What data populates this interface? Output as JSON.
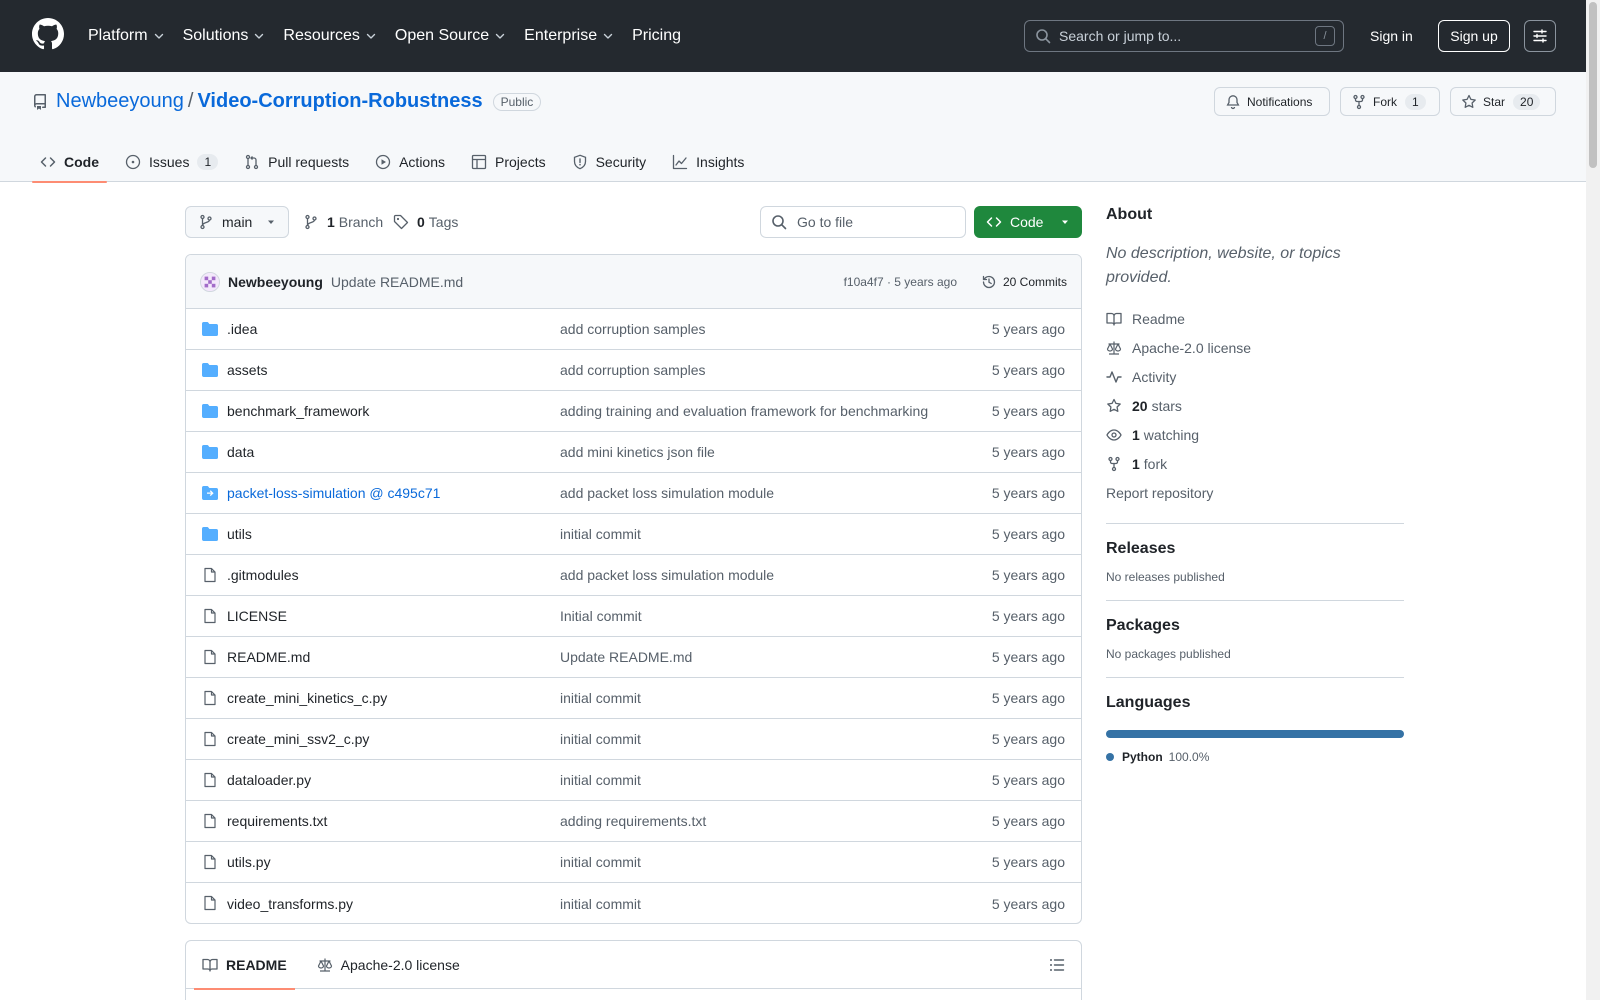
{
  "header": {
    "nav": [
      {
        "label": "Platform",
        "dropdown": true
      },
      {
        "label": "Solutions",
        "dropdown": true
      },
      {
        "label": "Resources",
        "dropdown": true
      },
      {
        "label": "Open Source",
        "dropdown": true
      },
      {
        "label": "Enterprise",
        "dropdown": true
      },
      {
        "label": "Pricing",
        "dropdown": false
      }
    ],
    "search_placeholder": "Search or jump to...",
    "search_key": "/",
    "signin": "Sign in",
    "signup": "Sign up"
  },
  "repo": {
    "owner": "Newbeeyoung",
    "separator": "/",
    "name": "Video-Corruption-Robustness",
    "visibility": "Public",
    "notifications_label": "Notifications",
    "fork_label": "Fork",
    "fork_count": "1",
    "star_label": "Star",
    "star_count": "20"
  },
  "tabs": [
    {
      "label": "Code",
      "icon": "code-icon",
      "active": true,
      "count": ""
    },
    {
      "label": "Issues",
      "icon": "issue-opened-icon",
      "active": false,
      "count": "1"
    },
    {
      "label": "Pull requests",
      "icon": "git-pull-request-icon",
      "active": false,
      "count": ""
    },
    {
      "label": "Actions",
      "icon": "play-icon",
      "active": false,
      "count": ""
    },
    {
      "label": "Projects",
      "icon": "table-icon",
      "active": false,
      "count": ""
    },
    {
      "label": "Security",
      "icon": "shield-icon",
      "active": false,
      "count": ""
    },
    {
      "label": "Insights",
      "icon": "graph-icon",
      "active": false,
      "count": ""
    }
  ],
  "toolbar": {
    "branch": "main",
    "branch_count": "1",
    "branch_label": "Branch",
    "tag_count": "0",
    "tag_label": "Tags",
    "goto_placeholder": "Go to file",
    "code_button": "Code"
  },
  "latest_commit": {
    "author": "Newbeeyoung",
    "message": "Update README.md",
    "hash": "f10a4f7",
    "age": "5 years ago",
    "meta": "f10a4f7 · 5 years ago",
    "commits_label": "20 Commits"
  },
  "files": [
    {
      "name": ".idea",
      "type": "folder",
      "message": "add corruption samples",
      "date": "5 years ago"
    },
    {
      "name": "assets",
      "type": "folder",
      "message": "add corruption samples",
      "date": "5 years ago"
    },
    {
      "name": "benchmark_framework",
      "type": "folder",
      "message": "adding training and evaluation framework for benchmarking",
      "date": "5 years ago"
    },
    {
      "name": "data",
      "type": "folder",
      "message": "add mini kinetics json file",
      "date": "5 years ago"
    },
    {
      "name": "packet-loss-simulation @ c495c71",
      "type": "submodule",
      "message": "add packet loss simulation module",
      "date": "5 years ago"
    },
    {
      "name": "utils",
      "type": "folder",
      "message": "initial commit",
      "date": "5 years ago"
    },
    {
      "name": ".gitmodules",
      "type": "file",
      "message": "add packet loss simulation module",
      "date": "5 years ago"
    },
    {
      "name": "LICENSE",
      "type": "file",
      "message": "Initial commit",
      "date": "5 years ago"
    },
    {
      "name": "README.md",
      "type": "file",
      "message": "Update README.md",
      "date": "5 years ago"
    },
    {
      "name": "create_mini_kinetics_c.py",
      "type": "file",
      "message": "initial commit",
      "date": "5 years ago"
    },
    {
      "name": "create_mini_ssv2_c.py",
      "type": "file",
      "message": "initial commit",
      "date": "5 years ago"
    },
    {
      "name": "dataloader.py",
      "type": "file",
      "message": "initial commit",
      "date": "5 years ago"
    },
    {
      "name": "requirements.txt",
      "type": "file",
      "message": "adding requirements.txt",
      "date": "5 years ago"
    },
    {
      "name": "utils.py",
      "type": "file",
      "message": "initial commit",
      "date": "5 years ago"
    },
    {
      "name": "video_transforms.py",
      "type": "file",
      "message": "initial commit",
      "date": "5 years ago"
    }
  ],
  "readme_tabs": [
    {
      "label": "README",
      "icon": "book-icon",
      "active": true
    },
    {
      "label": "Apache-2.0 license",
      "icon": "law-icon",
      "active": false
    }
  ],
  "sidebar": {
    "about_title": "About",
    "about_desc": "No description, website, or topics provided.",
    "links": [
      {
        "icon": "book-icon",
        "count": "",
        "label": "Readme"
      },
      {
        "icon": "law-icon",
        "count": "",
        "label": "Apache-2.0 license"
      },
      {
        "icon": "pulse-icon",
        "count": "",
        "label": "Activity"
      },
      {
        "icon": "star-icon",
        "count": "20",
        "label": "stars"
      },
      {
        "icon": "eye-icon",
        "count": "1",
        "label": "watching"
      },
      {
        "icon": "repo-forked-icon",
        "count": "1",
        "label": "fork"
      }
    ],
    "report": "Report repository",
    "releases_title": "Releases",
    "releases_sub": "No releases published",
    "packages_title": "Packages",
    "packages_sub": "No packages published",
    "languages_title": "Languages",
    "languages": [
      {
        "name": "Python",
        "percent": "100.0%",
        "color": "#3572A5"
      }
    ]
  },
  "colors": {
    "accent": "#0969da",
    "header_bg": "#24292f",
    "code_green": "#1f883d",
    "tab_underline": "#fd8c73",
    "folder": "#54aeff"
  }
}
